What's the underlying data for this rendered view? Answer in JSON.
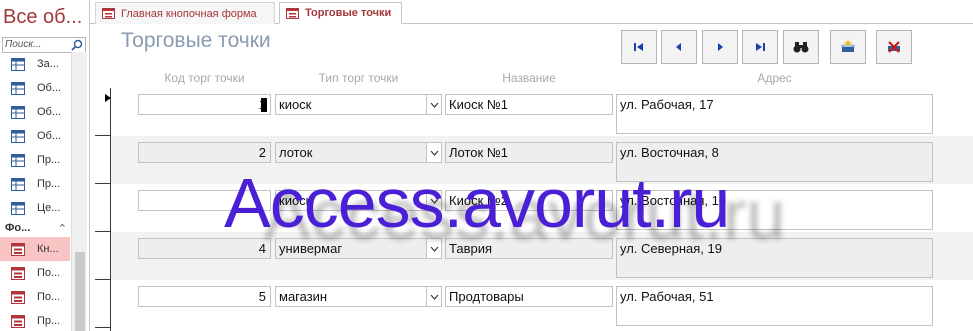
{
  "navigation_pane": {
    "title": "Все об...",
    "search_placeholder": "Поиск...",
    "tables_items": [
      {
        "label": "За...",
        "icon": "table-icon"
      },
      {
        "label": "Об...",
        "icon": "table-icon"
      },
      {
        "label": "Об...",
        "icon": "table-icon"
      },
      {
        "label": "Об...",
        "icon": "table-icon"
      },
      {
        "label": "Пр...",
        "icon": "table-icon"
      },
      {
        "label": "Пр...",
        "icon": "table-icon"
      },
      {
        "label": "Це...",
        "icon": "table-icon"
      }
    ],
    "forms_group": "Фо...",
    "forms_items": [
      {
        "label": "Кн...",
        "icon": "form-icon",
        "selected": true
      },
      {
        "label": "По...",
        "icon": "form-icon"
      },
      {
        "label": "По...",
        "icon": "form-icon"
      },
      {
        "label": "Пр...",
        "icon": "form-icon"
      }
    ]
  },
  "tabs": [
    {
      "label": "Главная кнопочная форма",
      "active": false
    },
    {
      "label": "Торговые точки",
      "active": true
    }
  ],
  "form": {
    "title": "Торговые точки",
    "nav_buttons": [
      "first-record-icon",
      "previous-record-icon",
      "next-record-icon",
      "last-record-icon",
      "find-icon",
      "new-record-icon",
      "delete-record-icon"
    ],
    "columns": {
      "code": "Код торг точки",
      "type": "Тип торг точки",
      "name": "Название",
      "address": "Адрес"
    },
    "records": [
      {
        "code": "1",
        "type": "киоск",
        "name": "Киоск №1",
        "address": "ул. Рабочая, 17"
      },
      {
        "code": "2",
        "type": "лоток",
        "name": "Лоток №1",
        "address": "ул. Восточная, 8"
      },
      {
        "code": "",
        "type": "киоск",
        "name": "Киоск №2",
        "address": "ул. Восточная, 10"
      },
      {
        "code": "4",
        "type": "универмаг",
        "name": "Таврия",
        "address": "ул. Северная, 19"
      },
      {
        "code": "5",
        "type": "магазин",
        "name": "Продтовары",
        "address": "ул. Рабочая, 51"
      }
    ]
  },
  "watermark": "Access.avorut.ru",
  "colors": {
    "accent": "#a4373a",
    "watermark": "#4a1fd6",
    "form_title": "#8a9bb2",
    "selected_nav": "#f8c4c4"
  }
}
